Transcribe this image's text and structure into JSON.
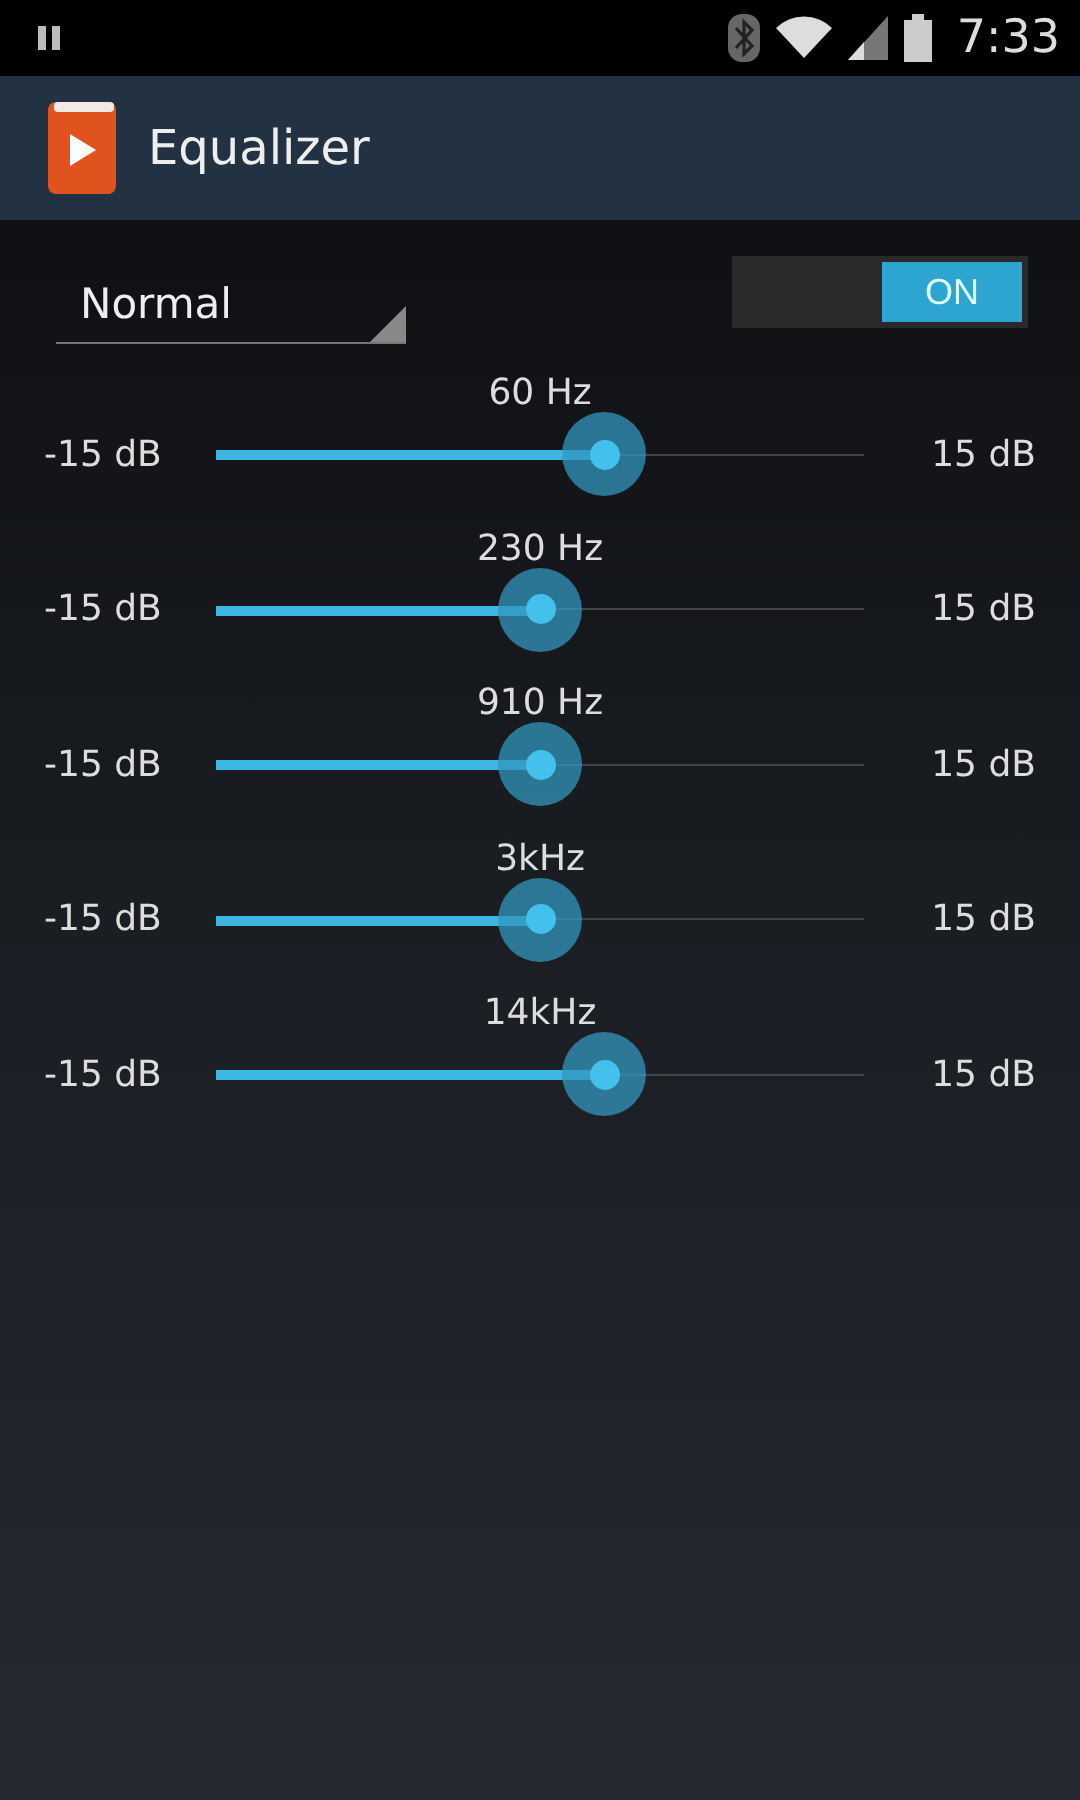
{
  "status_bar": {
    "time": "7:33"
  },
  "action_bar": {
    "title": "Equalizer"
  },
  "preset": {
    "value": "Normal"
  },
  "toggle": {
    "label": "ON",
    "on": true
  },
  "bands": [
    {
      "name": "60 Hz",
      "min": "-15 dB",
      "max": "15 dB",
      "level": 0.6
    },
    {
      "name": "230 Hz",
      "min": "-15 dB",
      "max": "15 dB",
      "level": 0.5
    },
    {
      "name": "910 Hz",
      "min": "-15 dB",
      "max": "15 dB",
      "level": 0.5
    },
    {
      "name": "3kHz",
      "min": "-15 dB",
      "max": "15 dB",
      "level": 0.5
    },
    {
      "name": "14kHz",
      "min": "-15 dB",
      "max": "15 dB",
      "level": 0.6
    }
  ]
}
